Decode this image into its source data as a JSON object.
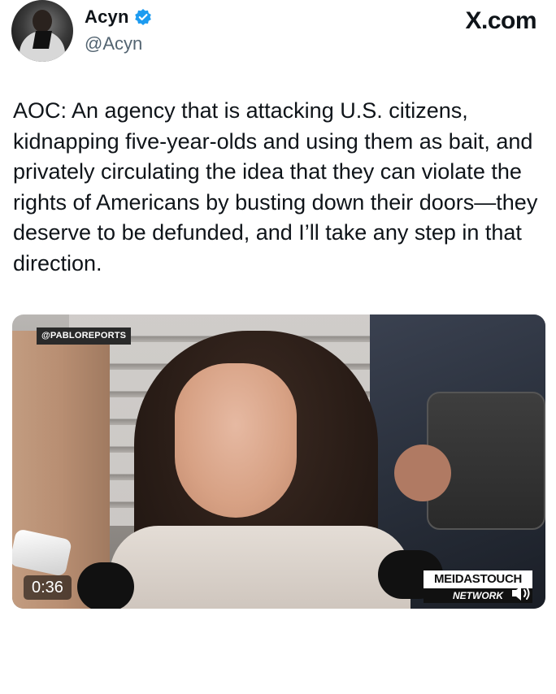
{
  "author": {
    "name": "Acyn",
    "handle": "@Acyn"
  },
  "site": "X.com",
  "tweet": {
    "text": "AOC: An agency that is attacking U.S. citizens, kidnapping five-year-olds and using them as bait, and privately circulating the idea that they can violate the rights of Americans by busting down their doors—they deserve to be defunded, and I’ll take any step in that direction."
  },
  "media": {
    "source_tag": "@PABLOREPORTS",
    "duration": "0:36",
    "network_logo_top": "MEIDASTOUCH",
    "network_logo_bottom": "NETWORK"
  },
  "icons": {
    "verified": "verified-badge-icon",
    "mute": "speaker-icon"
  },
  "colors": {
    "verified_blue": "#1d9bf0",
    "handle_gray": "#536471",
    "text_dark": "#0f1419"
  }
}
